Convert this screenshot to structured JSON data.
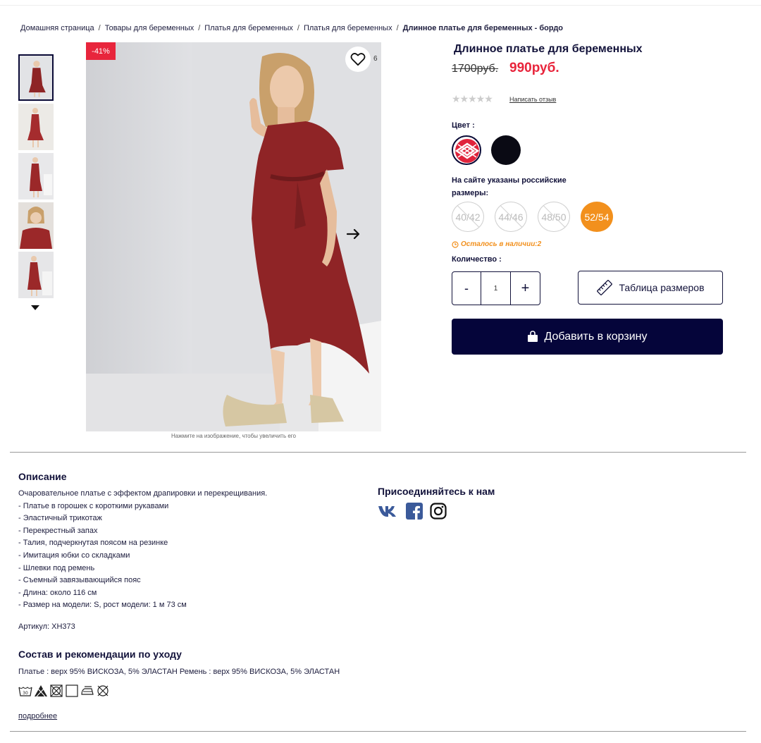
{
  "breadcrumb": {
    "items": [
      "Домашняя страница",
      "Товары для беременных",
      "Платья для беременных",
      "Платья для беременных"
    ],
    "separator": "/",
    "current": "Длинное платье для беременных - бордо"
  },
  "gallery": {
    "discount_badge": "-41%",
    "favorites_count": "6",
    "hint": "Нажмите на изображение, чтобы увеличить его",
    "thumbnails_count": 5,
    "active_thumbnail": 1
  },
  "product": {
    "title": "Длинное платье для беременных",
    "old_price": "1700руб.",
    "new_price": "990руб.",
    "rating": 0,
    "rating_max": 5,
    "review_link": "Написать отзыв",
    "color_label": "Цвет :",
    "colors": [
      {
        "name": "бордо",
        "hex": "#e0243c",
        "selected": true
      },
      {
        "name": "черный",
        "hex": "#0a0a14",
        "selected": false
      }
    ],
    "size_note": "На сайте указаны российские размеры:",
    "sizes": [
      {
        "label": "40/42",
        "available": false,
        "selected": false
      },
      {
        "label": "44/46",
        "available": false,
        "selected": false
      },
      {
        "label": "48/50",
        "available": false,
        "selected": false
      },
      {
        "label": "52/54",
        "available": true,
        "selected": true
      }
    ],
    "stock_text": "Осталось в наличии:2",
    "quantity_label": "Количество :",
    "quantity_minus": "-",
    "quantity_value": "1",
    "quantity_plus": "+",
    "size_table_button": "Таблица размеров",
    "add_to_cart_button": "Добавить в корзину"
  },
  "description": {
    "title": "Описание",
    "lines": [
      "Очаровательное платье с эффектом драпировки и перекрещивания.",
      "- Платье в горошек с короткими рукавами",
      "- Эластичный трикотаж",
      "- Перекрестный запах",
      "- Талия, подчеркнутая поясом на резинке",
      "- Имитация юбки со складками",
      "- Шлевки под ремень",
      "- Съемный завязывающийся пояс",
      "- Длина: около 116 см",
      "- Размер на модели: S, рост модели: 1 м 73 см"
    ],
    "article": "Артикул: XH373"
  },
  "composition": {
    "title": "Состав и рекомендации по уходу",
    "text": "Платье : верх 95% ВИСКОЗА, 5% ЭЛАСТАН Ремень : верх 95% ВИСКОЗА, 5% ЭЛАСТАН",
    "care_icons": [
      "wash-30-icon",
      "no-bleach-icon",
      "no-tumble-dry-icon",
      "dry-icon",
      "iron-icon",
      "no-dry-clean-icon"
    ],
    "wash_temp": "30",
    "more_link": "подробнее"
  },
  "social": {
    "title": "Присоединяйтесь к нам",
    "networks": [
      "vk-icon",
      "facebook-icon",
      "instagram-icon"
    ]
  },
  "colors": {
    "accent_red": "#e8253c",
    "accent_orange": "#f2901d",
    "navy": "#05053a",
    "social_blue": "#3b5a9a"
  }
}
